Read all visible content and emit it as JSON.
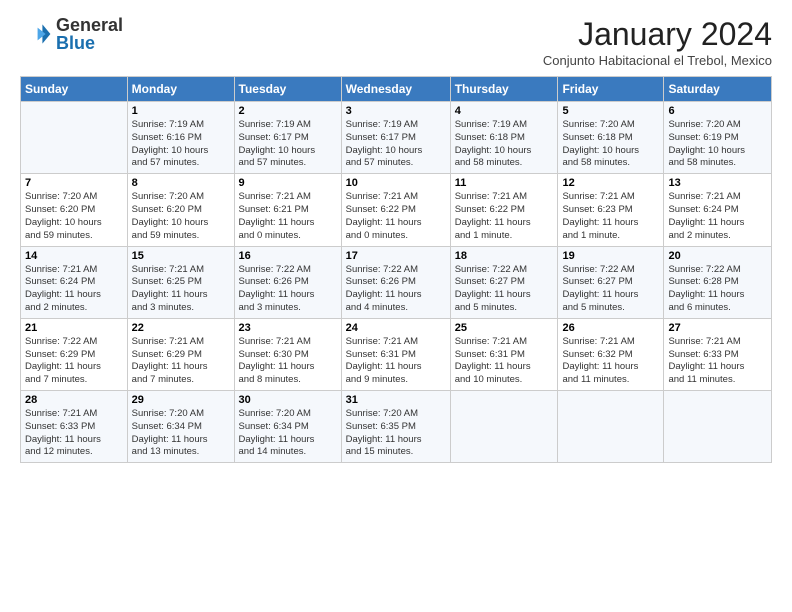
{
  "header": {
    "logo_general": "General",
    "logo_blue": "Blue",
    "title": "January 2024",
    "subtitle": "Conjunto Habitacional el Trebol, Mexico"
  },
  "weekdays": [
    "Sunday",
    "Monday",
    "Tuesday",
    "Wednesday",
    "Thursday",
    "Friday",
    "Saturday"
  ],
  "weeks": [
    [
      {
        "day": "",
        "info": ""
      },
      {
        "day": "1",
        "info": "Sunrise: 7:19 AM\nSunset: 6:16 PM\nDaylight: 10 hours\nand 57 minutes."
      },
      {
        "day": "2",
        "info": "Sunrise: 7:19 AM\nSunset: 6:17 PM\nDaylight: 10 hours\nand 57 minutes."
      },
      {
        "day": "3",
        "info": "Sunrise: 7:19 AM\nSunset: 6:17 PM\nDaylight: 10 hours\nand 57 minutes."
      },
      {
        "day": "4",
        "info": "Sunrise: 7:19 AM\nSunset: 6:18 PM\nDaylight: 10 hours\nand 58 minutes."
      },
      {
        "day": "5",
        "info": "Sunrise: 7:20 AM\nSunset: 6:18 PM\nDaylight: 10 hours\nand 58 minutes."
      },
      {
        "day": "6",
        "info": "Sunrise: 7:20 AM\nSunset: 6:19 PM\nDaylight: 10 hours\nand 58 minutes."
      }
    ],
    [
      {
        "day": "7",
        "info": "Sunrise: 7:20 AM\nSunset: 6:20 PM\nDaylight: 10 hours\nand 59 minutes."
      },
      {
        "day": "8",
        "info": "Sunrise: 7:20 AM\nSunset: 6:20 PM\nDaylight: 10 hours\nand 59 minutes."
      },
      {
        "day": "9",
        "info": "Sunrise: 7:21 AM\nSunset: 6:21 PM\nDaylight: 11 hours\nand 0 minutes."
      },
      {
        "day": "10",
        "info": "Sunrise: 7:21 AM\nSunset: 6:22 PM\nDaylight: 11 hours\nand 0 minutes."
      },
      {
        "day": "11",
        "info": "Sunrise: 7:21 AM\nSunset: 6:22 PM\nDaylight: 11 hours\nand 1 minute."
      },
      {
        "day": "12",
        "info": "Sunrise: 7:21 AM\nSunset: 6:23 PM\nDaylight: 11 hours\nand 1 minute."
      },
      {
        "day": "13",
        "info": "Sunrise: 7:21 AM\nSunset: 6:24 PM\nDaylight: 11 hours\nand 2 minutes."
      }
    ],
    [
      {
        "day": "14",
        "info": "Sunrise: 7:21 AM\nSunset: 6:24 PM\nDaylight: 11 hours\nand 2 minutes."
      },
      {
        "day": "15",
        "info": "Sunrise: 7:21 AM\nSunset: 6:25 PM\nDaylight: 11 hours\nand 3 minutes."
      },
      {
        "day": "16",
        "info": "Sunrise: 7:22 AM\nSunset: 6:26 PM\nDaylight: 11 hours\nand 3 minutes."
      },
      {
        "day": "17",
        "info": "Sunrise: 7:22 AM\nSunset: 6:26 PM\nDaylight: 11 hours\nand 4 minutes."
      },
      {
        "day": "18",
        "info": "Sunrise: 7:22 AM\nSunset: 6:27 PM\nDaylight: 11 hours\nand 5 minutes."
      },
      {
        "day": "19",
        "info": "Sunrise: 7:22 AM\nSunset: 6:27 PM\nDaylight: 11 hours\nand 5 minutes."
      },
      {
        "day": "20",
        "info": "Sunrise: 7:22 AM\nSunset: 6:28 PM\nDaylight: 11 hours\nand 6 minutes."
      }
    ],
    [
      {
        "day": "21",
        "info": "Sunrise: 7:22 AM\nSunset: 6:29 PM\nDaylight: 11 hours\nand 7 minutes."
      },
      {
        "day": "22",
        "info": "Sunrise: 7:21 AM\nSunset: 6:29 PM\nDaylight: 11 hours\nand 7 minutes."
      },
      {
        "day": "23",
        "info": "Sunrise: 7:21 AM\nSunset: 6:30 PM\nDaylight: 11 hours\nand 8 minutes."
      },
      {
        "day": "24",
        "info": "Sunrise: 7:21 AM\nSunset: 6:31 PM\nDaylight: 11 hours\nand 9 minutes."
      },
      {
        "day": "25",
        "info": "Sunrise: 7:21 AM\nSunset: 6:31 PM\nDaylight: 11 hours\nand 10 minutes."
      },
      {
        "day": "26",
        "info": "Sunrise: 7:21 AM\nSunset: 6:32 PM\nDaylight: 11 hours\nand 11 minutes."
      },
      {
        "day": "27",
        "info": "Sunrise: 7:21 AM\nSunset: 6:33 PM\nDaylight: 11 hours\nand 11 minutes."
      }
    ],
    [
      {
        "day": "28",
        "info": "Sunrise: 7:21 AM\nSunset: 6:33 PM\nDaylight: 11 hours\nand 12 minutes."
      },
      {
        "day": "29",
        "info": "Sunrise: 7:20 AM\nSunset: 6:34 PM\nDaylight: 11 hours\nand 13 minutes."
      },
      {
        "day": "30",
        "info": "Sunrise: 7:20 AM\nSunset: 6:34 PM\nDaylight: 11 hours\nand 14 minutes."
      },
      {
        "day": "31",
        "info": "Sunrise: 7:20 AM\nSunset: 6:35 PM\nDaylight: 11 hours\nand 15 minutes."
      },
      {
        "day": "",
        "info": ""
      },
      {
        "day": "",
        "info": ""
      },
      {
        "day": "",
        "info": ""
      }
    ]
  ]
}
